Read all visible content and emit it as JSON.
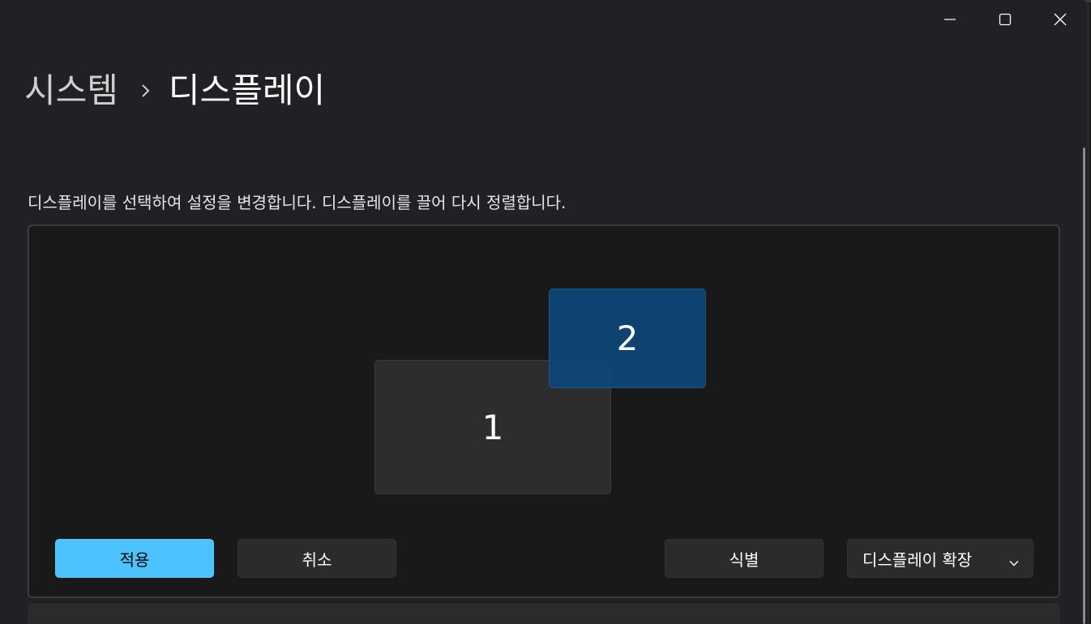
{
  "window": {
    "caption_icons": {
      "minimize": "minimize-icon",
      "maximize": "maximize-icon",
      "close": "close-icon"
    }
  },
  "breadcrumb": {
    "parent": "시스템",
    "separator_icon": "chevron-right-icon",
    "current": "디스플레이"
  },
  "instruction": "디스플레이를 선택하여 설정을 변경합니다. 디스플레이를 끌어 다시 정렬합니다.",
  "arrangement": {
    "monitors": [
      {
        "label": "1",
        "selected": false
      },
      {
        "label": "2",
        "selected": true
      }
    ],
    "accent_color": "#4cc2ff",
    "selected_monitor_color": "#0e4678"
  },
  "actions": {
    "apply": "적용",
    "cancel": "취소",
    "identify": "식별",
    "mode_select": {
      "value": "디스플레이 확장",
      "icon": "chevron-down-icon"
    }
  }
}
